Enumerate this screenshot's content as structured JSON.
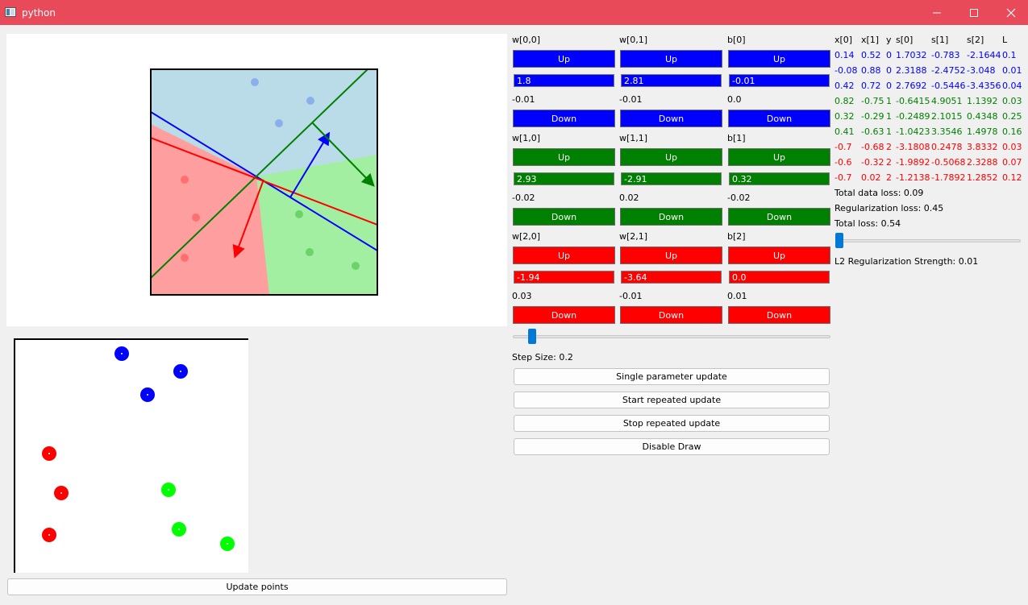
{
  "window": {
    "title": "python"
  },
  "colors": {
    "titlebar": "#e84a59",
    "blue": "#0000ff",
    "green": "#008000",
    "red": "#ff0000"
  },
  "params": {
    "w00": {
      "label": "w[0,0]",
      "up": "Up",
      "value": "1.8",
      "grad": "-0.01",
      "down": "Down"
    },
    "w01": {
      "label": "w[0,1]",
      "up": "Up",
      "value": "2.81",
      "grad": "-0.01",
      "down": "Down"
    },
    "b0": {
      "label": "b[0]",
      "up": "Up",
      "value": "-0.01",
      "grad": "0.0",
      "down": "Down"
    },
    "w10": {
      "label": "w[1,0]",
      "up": "Up",
      "value": "2.93",
      "grad": "-0.02",
      "down": "Down"
    },
    "w11": {
      "label": "w[1,1]",
      "up": "Up",
      "value": "-2.91",
      "grad": "0.02",
      "down": "Down"
    },
    "b1": {
      "label": "b[1]",
      "up": "Up",
      "value": "0.32",
      "grad": "-0.02",
      "down": "Down"
    },
    "w20": {
      "label": "w[2,0]",
      "up": "Up",
      "value": "-1.94",
      "grad": "0.03",
      "down": "Down"
    },
    "w21": {
      "label": "w[2,1]",
      "up": "Up",
      "value": "-3.64",
      "grad": "-0.01",
      "down": "Down"
    },
    "b2": {
      "label": "b[2]",
      "up": "Up",
      "value": "0.0",
      "grad": "0.01",
      "down": "Down"
    }
  },
  "controls": {
    "step_size": "Step Size: 0.2",
    "step_slider_value": 0.05,
    "single_update": "Single parameter update",
    "start_repeated": "Start repeated update",
    "stop_repeated": "Stop repeated update",
    "disable_draw": "Disable Draw",
    "update_points": "Update points"
  },
  "table": {
    "headers": [
      "x[0]",
      "x[1]",
      "y",
      "s[0]",
      "s[1]",
      "s[2]",
      "L"
    ],
    "rows": [
      {
        "color": "#0000ff",
        "cells": [
          "0.14",
          "0.52",
          "0",
          "1.7032",
          "-0.783",
          "-2.1644",
          "0.1"
        ]
      },
      {
        "color": "#0000ff",
        "cells": [
          "-0.08",
          "0.88",
          "0",
          "2.3188",
          "-2.4752",
          "-3.048",
          "0.01"
        ]
      },
      {
        "color": "#0000ff",
        "cells": [
          "0.42",
          "0.72",
          "0",
          "2.7692",
          "-0.5446",
          "-3.4356",
          "0.04"
        ]
      },
      {
        "color": "#008000",
        "cells": [
          "0.82",
          "-0.75",
          "1",
          "-0.6415",
          "4.9051",
          "1.1392",
          "0.03"
        ]
      },
      {
        "color": "#008000",
        "cells": [
          "0.32",
          "-0.29",
          "1",
          "-0.2489",
          "2.1015",
          "0.4348",
          "0.25"
        ]
      },
      {
        "color": "#008000",
        "cells": [
          "0.41",
          "-0.63",
          "1",
          "-1.0423",
          "3.3546",
          "1.4978",
          "0.16"
        ]
      },
      {
        "color": "#ff0000",
        "cells": [
          "-0.7",
          "-0.68",
          "2",
          "-3.1808",
          "0.2478",
          "3.8332",
          "0.03"
        ]
      },
      {
        "color": "#ff0000",
        "cells": [
          "-0.6",
          "-0.32",
          "2",
          "-1.9892",
          "-0.5068",
          "2.3288",
          "0.07"
        ]
      },
      {
        "color": "#ff0000",
        "cells": [
          "-0.7",
          "0.02",
          "2",
          "-1.2138",
          "-1.7892",
          "1.2852",
          "0.12"
        ]
      }
    ]
  },
  "losses": {
    "data": "Total data loss: 0.09",
    "reg": "Regularization loss: 0.45",
    "total": "Total loss: 0.54",
    "l2": "L2 Regularization Strength: 0.01",
    "l2_slider_value": 0.0
  }
}
